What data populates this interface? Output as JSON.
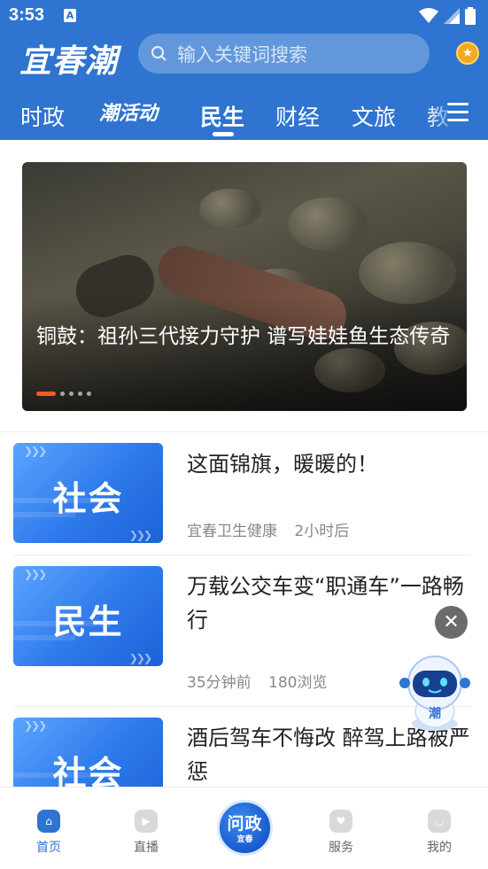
{
  "status_bar": {
    "time": "3:53",
    "notification_glyph": "A"
  },
  "header": {
    "logo": "宜春潮",
    "search_placeholder": "输入关键词搜索",
    "medal_icon": "medal-icon"
  },
  "tabs": [
    {
      "label": "时政",
      "active": false
    },
    {
      "label": "潮活动",
      "active": false
    },
    {
      "label": "民生",
      "active": true
    },
    {
      "label": "财经",
      "active": false
    },
    {
      "label": "文旅",
      "active": false
    },
    {
      "label": "教",
      "active": false
    }
  ],
  "banner": {
    "title": "铜鼓：祖孙三代接力守护 谱写娃娃鱼生态传奇",
    "slide_count": 5,
    "active_slide": 1
  },
  "news": [
    {
      "thumb_label": "社会",
      "title": "这面锦旗，暖暖的！",
      "meta": [
        "宜春卫生健康",
        "2小时后"
      ]
    },
    {
      "thumb_label": "民生",
      "title": "万载公交车变“职通车”一路畅行",
      "meta": [
        "35分钟前",
        "180浏览"
      ]
    },
    {
      "thumb_label": "社会",
      "title": "酒后驾车不悔改 醉驾上路被严惩",
      "meta": []
    }
  ],
  "floating": {
    "close": "✕",
    "robot_badge": "潮"
  },
  "bottom_nav": [
    {
      "label": "首页",
      "icon": "home-icon",
      "active": true
    },
    {
      "label": "直播",
      "icon": "play-icon",
      "active": false
    },
    {
      "label": "服务",
      "icon": "heart-icon",
      "active": false
    },
    {
      "label": "我的",
      "icon": "smile-icon",
      "active": false
    }
  ],
  "center_button": {
    "main": "问政",
    "sub": "宜春"
  },
  "colors": {
    "brand": "#2e74d0",
    "accent": "#f45a24",
    "text": "#222222",
    "meta": "#888888"
  }
}
